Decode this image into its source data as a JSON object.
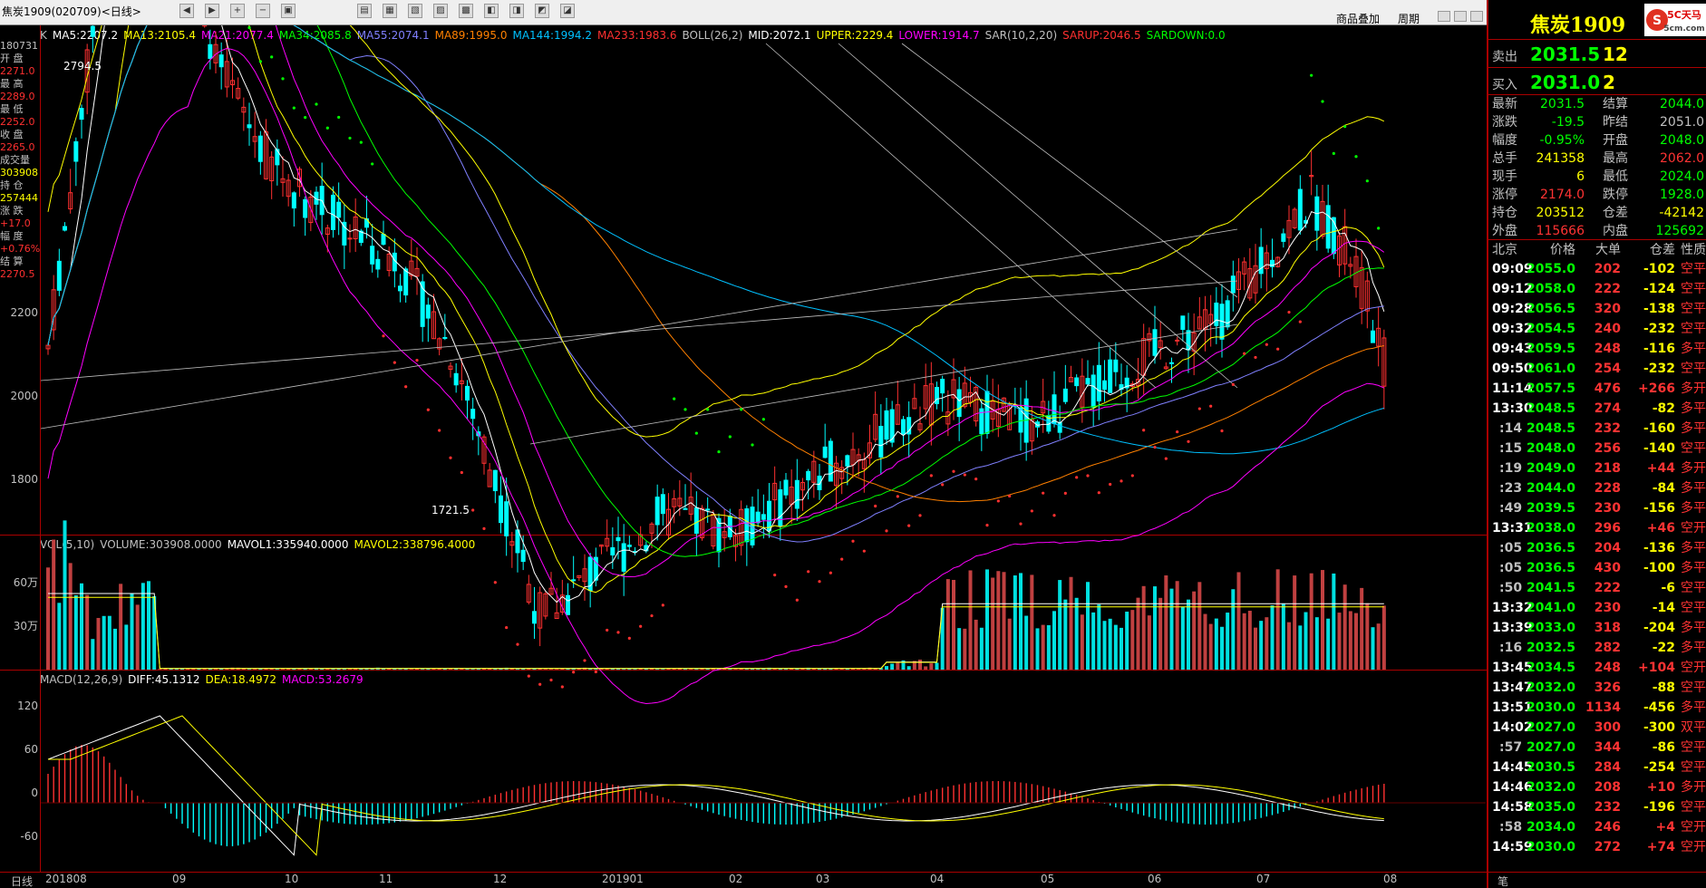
{
  "topbar": {
    "title": "焦炭1909(020709)<日线>",
    "link1": "商品叠加",
    "link2": "周期"
  },
  "legend": {
    "main": [
      {
        "t": "K",
        "c": "#c0c0c0"
      },
      {
        "t": "MA5:2207.2",
        "c": "#ffffff"
      },
      {
        "t": "MA13:2105.4",
        "c": "#ffff00"
      },
      {
        "t": "MA21:2077.4",
        "c": "#ff00ff"
      },
      {
        "t": "MA34:2085.8",
        "c": "#00ff00"
      },
      {
        "t": "MA55:2074.1",
        "c": "#8080ff"
      },
      {
        "t": "MA89:1995.0",
        "c": "#ff8000"
      },
      {
        "t": "MA144:1994.2",
        "c": "#00c0ff"
      },
      {
        "t": "MA233:1983.6",
        "c": "#ff3030"
      },
      {
        "t": "BOLL(26,2)",
        "c": "#c0c0c0"
      },
      {
        "t": "MID:2072.1",
        "c": "#ffffff"
      },
      {
        "t": "UPPER:2229.4",
        "c": "#ffff00"
      },
      {
        "t": "LOWER:1914.7",
        "c": "#ff00ff"
      },
      {
        "t": "SAR(10,2,20)",
        "c": "#c0c0c0"
      },
      {
        "t": "SARUP:2046.5",
        "c": "#ff3030"
      },
      {
        "t": "SARDOWN:0.0",
        "c": "#00ff00"
      }
    ],
    "vol": [
      {
        "t": "VOL(5,10)",
        "c": "#c0c0c0"
      },
      {
        "t": "VOLUME:303908.0000",
        "c": "#c0c0c0"
      },
      {
        "t": "MAVOL1:335940.0000",
        "c": "#ffffff"
      },
      {
        "t": "MAVOL2:338796.4000",
        "c": "#ffff00"
      }
    ],
    "macd": [
      {
        "t": "MACD(12,26,9)",
        "c": "#c0c0c0"
      },
      {
        "t": "DIFF:45.1312",
        "c": "#ffffff"
      },
      {
        "t": "DEA:18.4972",
        "c": "#ffff00"
      },
      {
        "t": "MACD:53.2679",
        "c": "#ff00ff"
      }
    ]
  },
  "info": [
    {
      "t": "180731",
      "c": "#c0c0c0"
    },
    {
      "t": "开 盘",
      "c": "#c0c0c0"
    },
    {
      "t": "2271.0",
      "c": "#ff3030"
    },
    {
      "t": "最 高",
      "c": "#c0c0c0"
    },
    {
      "t": "2289.0",
      "c": "#ff3030"
    },
    {
      "t": "最 低",
      "c": "#c0c0c0"
    },
    {
      "t": "2252.0",
      "c": "#ff3030"
    },
    {
      "t": "收 盘",
      "c": "#c0c0c0"
    },
    {
      "t": "2265.0",
      "c": "#ff3030"
    },
    {
      "t": "成交量",
      "c": "#c0c0c0"
    },
    {
      "t": "303908",
      "c": "#ffff00"
    },
    {
      "t": "持 仓",
      "c": "#c0c0c0"
    },
    {
      "t": "257444",
      "c": "#ffff00"
    },
    {
      "t": "涨 跌",
      "c": "#c0c0c0"
    },
    {
      "t": "+17.0",
      "c": "#ff3030"
    },
    {
      "t": "幅 度",
      "c": "#c0c0c0"
    },
    {
      "t": "+0.76%",
      "c": "#ff3030"
    },
    {
      "t": "结 算",
      "c": "#c0c0c0"
    },
    {
      "t": "2270.5",
      "c": "#ff3030"
    }
  ],
  "axes": {
    "price": [
      "2200",
      "2000",
      "1800"
    ],
    "vol": [
      "60万",
      "30万"
    ],
    "macd": [
      "120",
      "60",
      "0",
      "-60"
    ],
    "dates": [
      "201808",
      "09",
      "10",
      "11",
      "12",
      "201901",
      "02",
      "03",
      "04",
      "05",
      "06",
      "07",
      "08"
    ],
    "bottom_left": "日线",
    "ann_high": "2794.5",
    "ann_low": "1721.5"
  },
  "right": {
    "title": "焦炭1909",
    "logo": "5C天马 5cm.com",
    "sell_label": "卖出",
    "sell_price": "2031.5",
    "sell_vol": "12",
    "buy_label": "买入",
    "buy_price": "2031.0",
    "buy_vol": "2",
    "quote": [
      [
        "最新",
        "2031.5",
        "#0f0",
        "结算",
        "2044.0",
        "#0f0"
      ],
      [
        "涨跌",
        "-19.5",
        "#0f0",
        "昨结",
        "2051.0",
        "#c0c0c0"
      ],
      [
        "幅度",
        "-0.95%",
        "#0f0",
        "开盘",
        "2048.0",
        "#0f0"
      ],
      [
        "总手",
        "241358",
        "#ff0",
        "最高",
        "2062.0",
        "#f33"
      ],
      [
        "现手",
        "6",
        "#ff0",
        "最低",
        "2024.0",
        "#0f0"
      ],
      [
        "涨停",
        "2174.0",
        "#f33",
        "跌停",
        "1928.0",
        "#0f0"
      ],
      [
        "持仓",
        "203512",
        "#ff0",
        "仓差",
        "-42142",
        "#ff0"
      ],
      [
        "外盘",
        "115666",
        "#f33",
        "内盘",
        "125692",
        "#0f0"
      ]
    ],
    "trade_header": [
      "北京",
      "价格",
      "大单",
      "仓差",
      "性质"
    ],
    "trades": [
      [
        "09:09",
        "2055.0",
        "202",
        "-102",
        "空平"
      ],
      [
        "09:12",
        "2058.0",
        "222",
        "-124",
        "空平"
      ],
      [
        "09:28",
        "2056.5",
        "320",
        "-138",
        "空平"
      ],
      [
        "09:32",
        "2054.5",
        "240",
        "-232",
        "空平"
      ],
      [
        "09:43",
        "2059.5",
        "248",
        "-116",
        "多平"
      ],
      [
        "09:50",
        "2061.0",
        "254",
        "-232",
        "空平"
      ],
      [
        "11:14",
        "2057.5",
        "476",
        "+266",
        "多开"
      ],
      [
        "13:30",
        "2048.5",
        "274",
        "-82",
        "多平"
      ],
      [
        ":14",
        "2048.5",
        "232",
        "-160",
        "多平"
      ],
      [
        ":15",
        "2048.0",
        "256",
        "-140",
        "空平"
      ],
      [
        ":19",
        "2049.0",
        "218",
        "+44",
        "多开"
      ],
      [
        ":23",
        "2044.0",
        "228",
        "-84",
        "多平"
      ],
      [
        ":49",
        "2039.5",
        "230",
        "-156",
        "多平"
      ],
      [
        "13:31",
        "2038.0",
        "296",
        "+46",
        "空开"
      ],
      [
        ":05",
        "2036.5",
        "204",
        "-136",
        "多平"
      ],
      [
        ":05",
        "2036.5",
        "430",
        "-100",
        "多平"
      ],
      [
        ":50",
        "2041.5",
        "222",
        "-6",
        "空平"
      ],
      [
        "13:32",
        "2041.0",
        "230",
        "-14",
        "空平"
      ],
      [
        "13:39",
        "2033.0",
        "318",
        "-204",
        "多平"
      ],
      [
        ":16",
        "2032.5",
        "282",
        "-22",
        "多平"
      ],
      [
        "13:45",
        "2034.5",
        "248",
        "+104",
        "空开"
      ],
      [
        "13:47",
        "2032.0",
        "326",
        "-88",
        "空平"
      ],
      [
        "13:51",
        "2030.0",
        "1134",
        "-456",
        "多平"
      ],
      [
        "14:02",
        "2027.0",
        "300",
        "-300",
        "双平"
      ],
      [
        ":57",
        "2027.0",
        "344",
        "-86",
        "空平"
      ],
      [
        "14:45",
        "2030.5",
        "284",
        "-254",
        "空平"
      ],
      [
        "14:46",
        "2032.0",
        "208",
        "+10",
        "多开"
      ],
      [
        "14:58",
        "2035.0",
        "232",
        "-196",
        "空平"
      ],
      [
        ":58",
        "2034.0",
        "246",
        "+4",
        "空开"
      ],
      [
        "14:59",
        "2030.0",
        "272",
        "+74",
        "空开"
      ]
    ],
    "footer": "笔"
  }
}
